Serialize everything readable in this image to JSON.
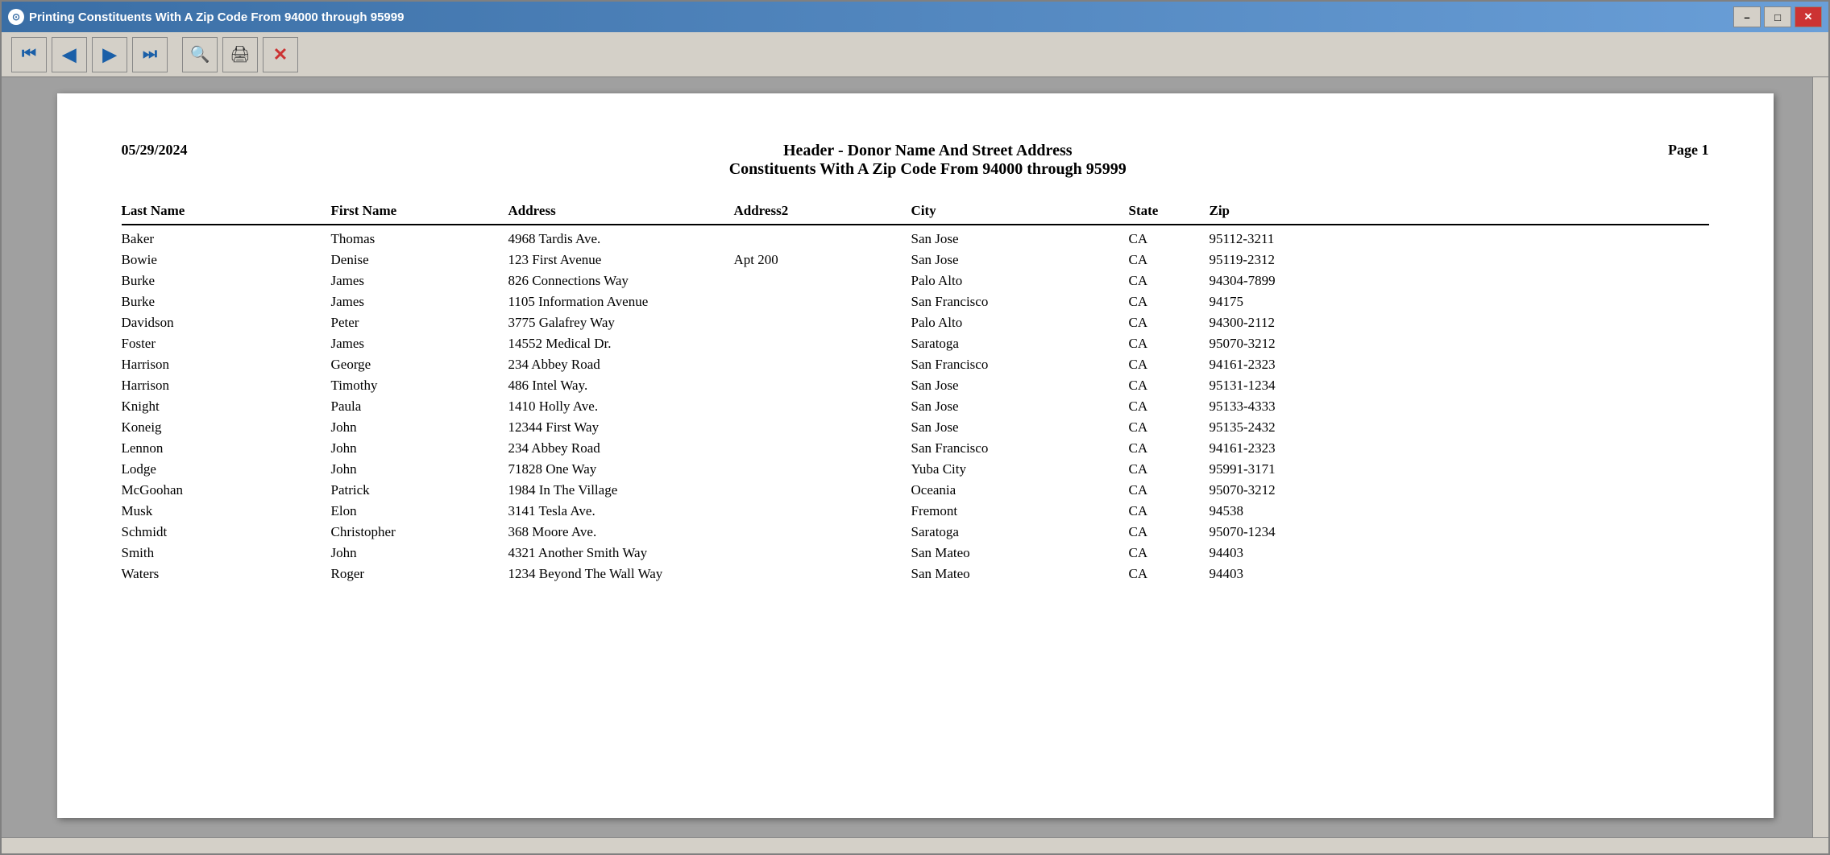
{
  "window": {
    "title": "Printing Constituents With A Zip Code From 94000 through 95999",
    "icon": "⊙",
    "minimize_label": "–",
    "maximize_label": "□",
    "close_label": "✕"
  },
  "toolbar": {
    "first_label": "⏮",
    "back_label": "←",
    "forward_label": "→",
    "last_label": "⏭",
    "search_label": "🔍",
    "print_label": "🖨",
    "cancel_label": "✕"
  },
  "page": {
    "date": "05/29/2024",
    "title_line1": "Header - Donor Name And Street Address",
    "title_line2": "Constituents With A Zip Code From 94000 through 95999",
    "page_label": "Page 1",
    "columns": {
      "last_name": "Last Name",
      "first_name": "First Name",
      "address": "Address",
      "address2": "Address2",
      "city": "City",
      "state": "State",
      "zip": "Zip"
    },
    "rows": [
      {
        "last": "Baker",
        "first": "Thomas",
        "address": "4968 Tardis Ave.",
        "address2": "",
        "city": "San Jose",
        "state": "CA",
        "zip": "95112-3211"
      },
      {
        "last": "Bowie",
        "first": "Denise",
        "address": "123 First Avenue",
        "address2": "Apt 200",
        "city": "San Jose",
        "state": "CA",
        "zip": "95119-2312"
      },
      {
        "last": "Burke",
        "first": "James",
        "address": "826 Connections Way",
        "address2": "",
        "city": "Palo Alto",
        "state": "CA",
        "zip": "94304-7899"
      },
      {
        "last": "Burke",
        "first": "James",
        "address": "1105 Information Avenue",
        "address2": "",
        "city": "San Francisco",
        "state": "CA",
        "zip": "94175"
      },
      {
        "last": "Davidson",
        "first": "Peter",
        "address": "3775 Galafrey Way",
        "address2": "",
        "city": "Palo Alto",
        "state": "CA",
        "zip": "94300-2112"
      },
      {
        "last": "Foster",
        "first": "James",
        "address": "14552 Medical Dr.",
        "address2": "",
        "city": "Saratoga",
        "state": "CA",
        "zip": "95070-3212"
      },
      {
        "last": "Harrison",
        "first": "George",
        "address": "234 Abbey Road",
        "address2": "",
        "city": "San Francisco",
        "state": "CA",
        "zip": "94161-2323"
      },
      {
        "last": "Harrison",
        "first": "Timothy",
        "address": "486 Intel Way.",
        "address2": "",
        "city": "San Jose",
        "state": "CA",
        "zip": "95131-1234"
      },
      {
        "last": "Knight",
        "first": "Paula",
        "address": "1410 Holly Ave.",
        "address2": "",
        "city": "San Jose",
        "state": "CA",
        "zip": "95133-4333"
      },
      {
        "last": "Koneig",
        "first": "John",
        "address": "12344 First Way",
        "address2": "",
        "city": "San Jose",
        "state": "CA",
        "zip": "95135-2432"
      },
      {
        "last": "Lennon",
        "first": "John",
        "address": "234 Abbey Road",
        "address2": "",
        "city": "San Francisco",
        "state": "CA",
        "zip": "94161-2323"
      },
      {
        "last": "Lodge",
        "first": "John",
        "address": "71828 One Way",
        "address2": "",
        "city": "Yuba City",
        "state": "CA",
        "zip": "95991-3171"
      },
      {
        "last": "McGoohan",
        "first": "Patrick",
        "address": "1984 In The Village",
        "address2": "",
        "city": "Oceania",
        "state": "CA",
        "zip": "95070-3212"
      },
      {
        "last": "Musk",
        "first": "Elon",
        "address": "3141 Tesla Ave.",
        "address2": "",
        "city": "Fremont",
        "state": "CA",
        "zip": "94538"
      },
      {
        "last": "Schmidt",
        "first": "Christopher",
        "address": "368 Moore Ave.",
        "address2": "",
        "city": "Saratoga",
        "state": "CA",
        "zip": "95070-1234"
      },
      {
        "last": "Smith",
        "first": "John",
        "address": "4321 Another Smith Way",
        "address2": "",
        "city": "San Mateo",
        "state": "CA",
        "zip": "94403"
      },
      {
        "last": "Waters",
        "first": "Roger",
        "address": "1234 Beyond The Wall Way",
        "address2": "",
        "city": "San Mateo",
        "state": "CA",
        "zip": "94403"
      }
    ]
  }
}
